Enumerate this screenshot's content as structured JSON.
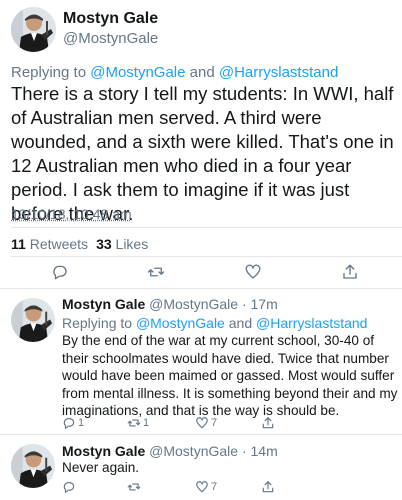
{
  "main_tweet": {
    "author_name": "Mostyn Gale",
    "author_handle": "@MostynGale",
    "replying_prefix": "Replying to ",
    "replying_user1": "@MostynGale",
    "replying_and": " and ",
    "replying_user2": "@Harryslaststand",
    "body": "There is a story I tell my students: In WWI, half of Australian men served. A third were wounded, and a sixth were killed. That's one in 12 Australian men who died in a four year period. I ask them to imagine if it was just before the war.",
    "timestamp": "13/10/18, 10:48 am",
    "retweets_count": "11",
    "retweets_label": "Retweets",
    "likes_count": "33",
    "likes_label": "Likes"
  },
  "replies": [
    {
      "author_name": "Mostyn Gale",
      "meta": "@MostynGale · 17m",
      "replying_prefix": "Replying to ",
      "replying_user1": "@MostynGale",
      "replying_and": " and ",
      "replying_user2": "@Harryslaststand",
      "body": "By the end of the war at my current school, 30-40 of their schoolmates would have died. Twice that number would have been maimed or gassed. Most would suffer from mental illness. It is something beyond their and my imaginations, and that is the way is should be.",
      "reply_count": "1",
      "retweet_count": "1",
      "like_count": "7"
    },
    {
      "author_name": "Mostyn Gale",
      "meta": "@MostynGale · 14m",
      "body": "Never again.",
      "like_count": "7"
    }
  ],
  "icons": {
    "reply": "reply-icon",
    "retweet": "retweet-icon",
    "like": "heart-icon",
    "share": "share-icon"
  },
  "colors": {
    "link": "#1da1f2",
    "secondary_text": "#657786",
    "primary_text": "#14171a",
    "divider": "#e1e8ed"
  }
}
